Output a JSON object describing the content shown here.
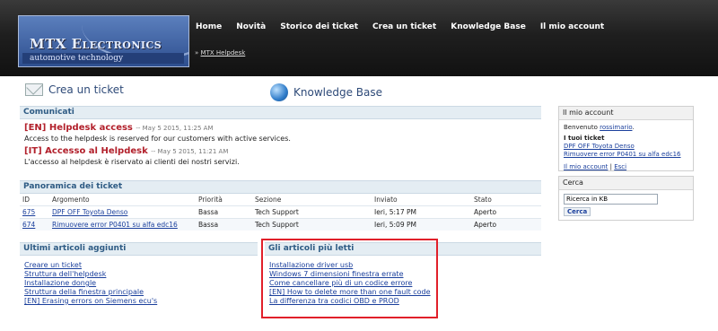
{
  "logo": {
    "title": "MTX Electronics",
    "tagline": "automotive technology"
  },
  "nav": [
    "Home",
    "Novità",
    "Storico dei ticket",
    "Crea un ticket",
    "Knowledge Base",
    "Il mio account"
  ],
  "breadcrumb": {
    "sep": "»",
    "link": "MTX Helpdesk"
  },
  "big_links": {
    "create_ticket": "Crea un ticket",
    "knowledge_base": "Knowledge Base"
  },
  "news": {
    "title": "Comunicati",
    "items": [
      {
        "title": "[EN] Helpdesk access",
        "date": "-- May 5 2015, 11:25 AM",
        "body": "Access to the helpdesk is reserved for our customers with active services."
      },
      {
        "title": "[IT] Accesso al Helpdesk",
        "date": "-- May 5 2015, 11:21 AM",
        "body": "L'accesso al helpdesk è riservato ai clienti dei nostri servizi."
      }
    ]
  },
  "tickets": {
    "title": "Panoramica dei ticket",
    "headers": [
      "ID",
      "Argomento",
      "Priorità",
      "Sezione",
      "Inviato",
      "Stato"
    ],
    "rows": [
      [
        "675",
        "DPF OFF Toyota Denso",
        "Bassa",
        "Tech Support",
        "Ieri, 5:17 PM",
        "Aperto"
      ],
      [
        "674",
        "Rimuovere error P0401 su alfa edc16",
        "Bassa",
        "Tech Support",
        "Ieri, 5:09 PM",
        "Aperto"
      ]
    ]
  },
  "latest": {
    "title": "Ultimi articoli aggiunti",
    "items": [
      "Creare un ticket",
      "Struttura dell'helpdesk",
      "Installazione dongle",
      "Struttura della finestra principale",
      "[EN] Erasing errors on Siemens ecu's"
    ]
  },
  "popular": {
    "title": "Gli articoli più letti",
    "items": [
      "Installazione driver usb",
      "Windows 7 dimensioni finestra errate",
      "Come cancellare più di un codice errore",
      "[EN] How to delete more than one fault code",
      "La differenza tra codici OBD e PROD"
    ]
  },
  "account": {
    "title": "Il mio account",
    "welcome": "Benvenuto",
    "user": "rossimario",
    "user_suffix": ".",
    "your_tickets": "I tuoi ticket",
    "tickets": [
      "DPF OFF Toyota Denso",
      "Rimuovere error P0401 su alfa edc16"
    ],
    "my_account": "Il mio account",
    "sep": "|",
    "logout": "Esci"
  },
  "search": {
    "title": "Cerca",
    "placeholder": "Ricerca in KB",
    "button": "Cerca"
  }
}
